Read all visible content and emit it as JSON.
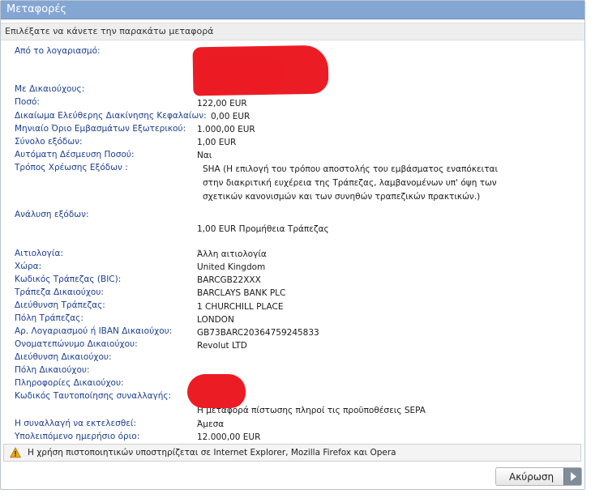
{
  "window": {
    "title": "Μεταφορές"
  },
  "subtitle": "Επιλέξατε να κάνετε την παρακάτω μεταφορά",
  "fields": {
    "from_account": {
      "label": "Από το λογαριασμό:"
    },
    "beneficiaries": {
      "label": "Με Δικαιούχους:"
    },
    "amount": {
      "label": "Ποσό:",
      "value": "122,00 EUR"
    },
    "free_capital_right": {
      "label": "Δικαίωμα Ελεύθερης Διακίνησης Κεφαλαίων:",
      "value": "0,00 EUR"
    },
    "monthly_limit": {
      "label": "Μηνιαίο Όριο Εμβασμάτων Εξωτερικού:",
      "value": "1.000,00 EUR"
    },
    "total_fees": {
      "label": "Σύνολο εξόδων:",
      "value": "1,00 EUR"
    },
    "auto_commitment": {
      "label": "Αυτόματη Δέσμευση Ποσού:",
      "value": "Ναι"
    },
    "charge_method": {
      "label": "Τρόπος Χρέωσης Εξόδων :",
      "value": "SHA (Η επιλογή του τρόπου αποστολής του εμβάσματος εναπόκειται στην διακριτική ευχέρεια της Τράπεζας, λαμβανομένων υπ' όψη των σχετικών κανονισμών και των συνηθών τραπεζικών πρακτικών.)"
    },
    "fee_breakdown": {
      "label": "Ανάλυση εξόδων:",
      "value": "1,00 EUR Προμήθεια Τράπεζας"
    },
    "reason": {
      "label": "Αιτιολογία:",
      "value": "Άλλη αιτιολογία"
    },
    "country": {
      "label": "Χώρα:",
      "value": "United Kingdom"
    },
    "bic": {
      "label": "Κωδικός Τράπεζας (BIC):",
      "value": "BARCGB22XXX"
    },
    "beneficiary_bank": {
      "label": "Τράπεζα Δικαιούχου:",
      "value": "BARCLAYS BANK PLC"
    },
    "bank_address": {
      "label": "Διεύθυνση Τράπεζας:",
      "value": "1 CHURCHILL PLACE"
    },
    "bank_city": {
      "label": "Πόλη Τράπεζας:",
      "value": "LONDON"
    },
    "iban": {
      "label": "Αρ. Λογαριασμού ή IBAN Δικαιούχου:",
      "value": "GB73BARC20364759245833"
    },
    "beneficiary_name": {
      "label": "Ονοματεπώνυμο Δικαιούχου:",
      "value": "Revolut LTD"
    },
    "beneficiary_address": {
      "label": "Διεύθυνση Δικαιούχου:"
    },
    "beneficiary_city": {
      "label": "Πόλη Δικαιούχου:"
    },
    "beneficiary_info": {
      "label": "Πληροφορίες Δικαιούχου:"
    },
    "transaction_id": {
      "label": "Κωδικός Ταυτοποίησης συναλλαγής:"
    },
    "sepa_note": "Η μεταφορά πίστωσης πληροί τις προϋποθέσεις SEPA",
    "execution": {
      "label": "Η συναλλαγή να εκτελεσθεί:",
      "value": "Άμεσα"
    },
    "daily_remaining": {
      "label": "Υπολειπόμενο ημερήσιο όριο:",
      "value": "12.000,00 EUR"
    }
  },
  "info_bar": {
    "icon": "warning-icon",
    "text": "Η χρήση πιστοποιητικών υποστηρίζεται σε Internet Explorer, Mozilla Firefox και Opera"
  },
  "buttons": {
    "cancel": "Ακύρωση"
  },
  "colors": {
    "titlebar": "#84a6d3",
    "label": "#1c3e8f",
    "redaction": "#ec1c24"
  }
}
